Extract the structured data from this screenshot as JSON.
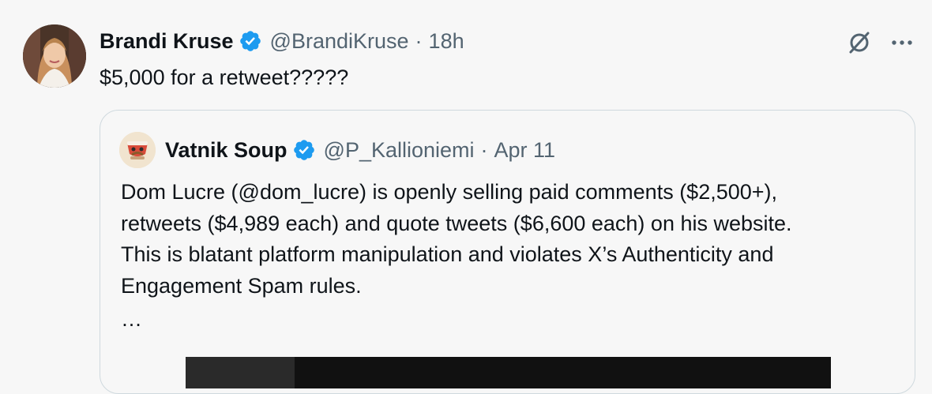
{
  "tweet": {
    "author_name": "Brandi Kruse",
    "author_handle": "@BrandiKruse",
    "separator": "·",
    "time": "18h",
    "text": "$5,000 for a retweet?????",
    "verified_icon": "verified-badge-icon",
    "grok_icon": "grok-icon",
    "more_icon": "more-options-icon"
  },
  "quote": {
    "author_name": "Vatnik Soup",
    "author_handle": "@P_Kallioniemi",
    "separator": "·",
    "date": "Apr 11",
    "text_lines": [
      "Dom Lucre (@dom_lucre) is openly selling paid comments ($2,500+),",
      "retweets ($4,989 each) and quote tweets ($6,600 each) on his website.",
      "This is blatant platform manipulation and violates X’s Authenticity and",
      "Engagement Spam rules."
    ],
    "ellipsis": "…",
    "verified_icon": "verified-badge-icon"
  },
  "colors": {
    "background": "#f7f7f7",
    "text_primary": "#0f1419",
    "text_secondary": "#536471",
    "verified_blue": "#1d9bf0",
    "border": "#cfd9de"
  }
}
